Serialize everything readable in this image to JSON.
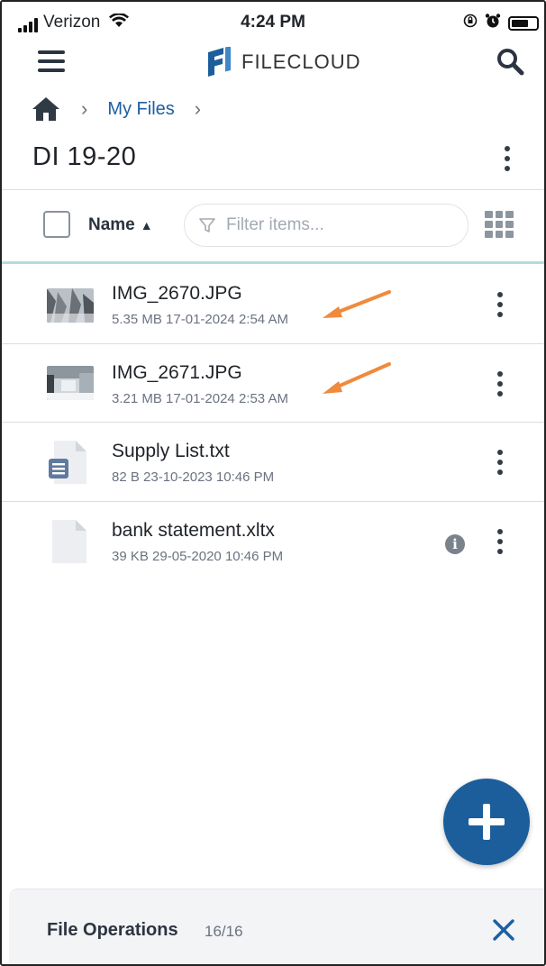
{
  "status_bar": {
    "carrier": "Verizon",
    "time": "4:24 PM"
  },
  "header": {
    "logo_text": "FILECLOUD",
    "icons": [
      "menu-icon",
      "filecloud-logo",
      "search-icon"
    ]
  },
  "breadcrumb": {
    "home_icon": "home-icon",
    "items": [
      {
        "label": "My Files"
      }
    ]
  },
  "folder": {
    "title": "DI 19-20"
  },
  "toolbar": {
    "sort_label": "Name",
    "sort_direction": "ascending",
    "filter_placeholder": "Filter items...",
    "view_icon": "grid-view-icon"
  },
  "files": [
    {
      "name": "IMG_2670.JPG",
      "size": "5.35 MB",
      "modified": "17-01-2024 2:54 AM",
      "type": "image",
      "highlighted": true
    },
    {
      "name": "IMG_2671.JPG",
      "size": "3.21 MB",
      "modified": "17-01-2024 2:53 AM",
      "type": "image",
      "highlighted": true
    },
    {
      "name": "Supply List.txt",
      "size": "82 B",
      "modified": "23-10-2023 10:46 PM",
      "type": "text"
    },
    {
      "name": "bank statement.xltx",
      "size": "39 KB",
      "modified": "29-05-2020 10:46 PM",
      "type": "document",
      "has_info": true
    }
  ],
  "fab": {
    "icon": "plus-icon"
  },
  "file_operations": {
    "label": "File Operations",
    "count": "16/16"
  },
  "colors": {
    "accent_blue": "#1b5e9b",
    "link_blue": "#1d5fa1",
    "annotation_orange": "#f08a3c",
    "divider_teal": "#b4dcdc"
  }
}
